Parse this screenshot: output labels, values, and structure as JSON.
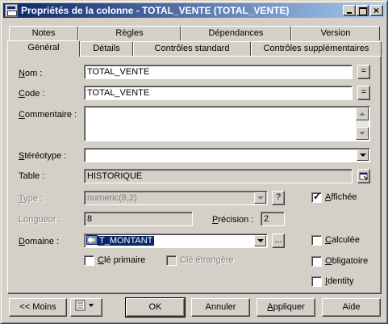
{
  "window": {
    "title": "Propriétés de la colonne - TOTAL_VENTE (TOTAL_VENTE)",
    "close_glyph": "×"
  },
  "tabs": {
    "row_back": [
      "Notes",
      "Règles",
      "Dépendances",
      "Version"
    ],
    "row_front": [
      "Général",
      "Détails",
      "Contrôles standard",
      "Contrôles supplémentaires"
    ],
    "active": "Général"
  },
  "form": {
    "nom": {
      "label_prefix": "N",
      "label_rest": "om :",
      "value": "TOTAL_VENTE",
      "btn": "="
    },
    "code": {
      "label_prefix": "C",
      "label_rest": "ode :",
      "value": "TOTAL_VENTE",
      "btn": "="
    },
    "commentaire": {
      "label_prefix": "C",
      "label_rest": "ommentaire :",
      "value": ""
    },
    "stereotype": {
      "label_prefix": "S",
      "label_rest": "téréotype :",
      "value": ""
    },
    "table": {
      "label": "Table :",
      "value": "HISTORIQUE"
    },
    "type": {
      "label_prefix": "T",
      "label_rest": "ype :",
      "value": "numeric(8,2)",
      "help_btn": "?"
    },
    "affichee": {
      "label_prefix": "A",
      "label_rest": "ffichée",
      "checked": true
    },
    "longueur": {
      "label": "Longueur :",
      "value": "8"
    },
    "precision": {
      "label_prefix": "P",
      "label_rest": "récision :",
      "value": "2"
    },
    "domaine": {
      "label_prefix": "D",
      "label_rest": "omaine :",
      "value": "T_MONTANT",
      "ellipsis_btn": "..."
    },
    "calculee": {
      "label_prefix": "C",
      "label_rest": "alculée",
      "checked": false
    },
    "cle_primaire": {
      "label_prefix": "C",
      "label_rest": "lé primaire",
      "checked": false
    },
    "cle_etrangere": {
      "label": "Clé étrangère",
      "checked": false
    },
    "obligatoire": {
      "label_prefix": "O",
      "label_rest": "bligatoire",
      "checked": false
    },
    "identity": {
      "label_prefix": "I",
      "label_rest": "dentity",
      "checked": false
    }
  },
  "buttons": {
    "moins": "<< Moins",
    "ok": "OK",
    "annuler": "Annuler",
    "appliquer_prefix": "A",
    "appliquer_rest": "ppliquer",
    "aide": "Aide"
  },
  "colors": {
    "title_gradient_start": "#0a246a",
    "title_gradient_end": "#a6caf0",
    "face": "#d4d0c8",
    "selection": "#0a246a"
  }
}
